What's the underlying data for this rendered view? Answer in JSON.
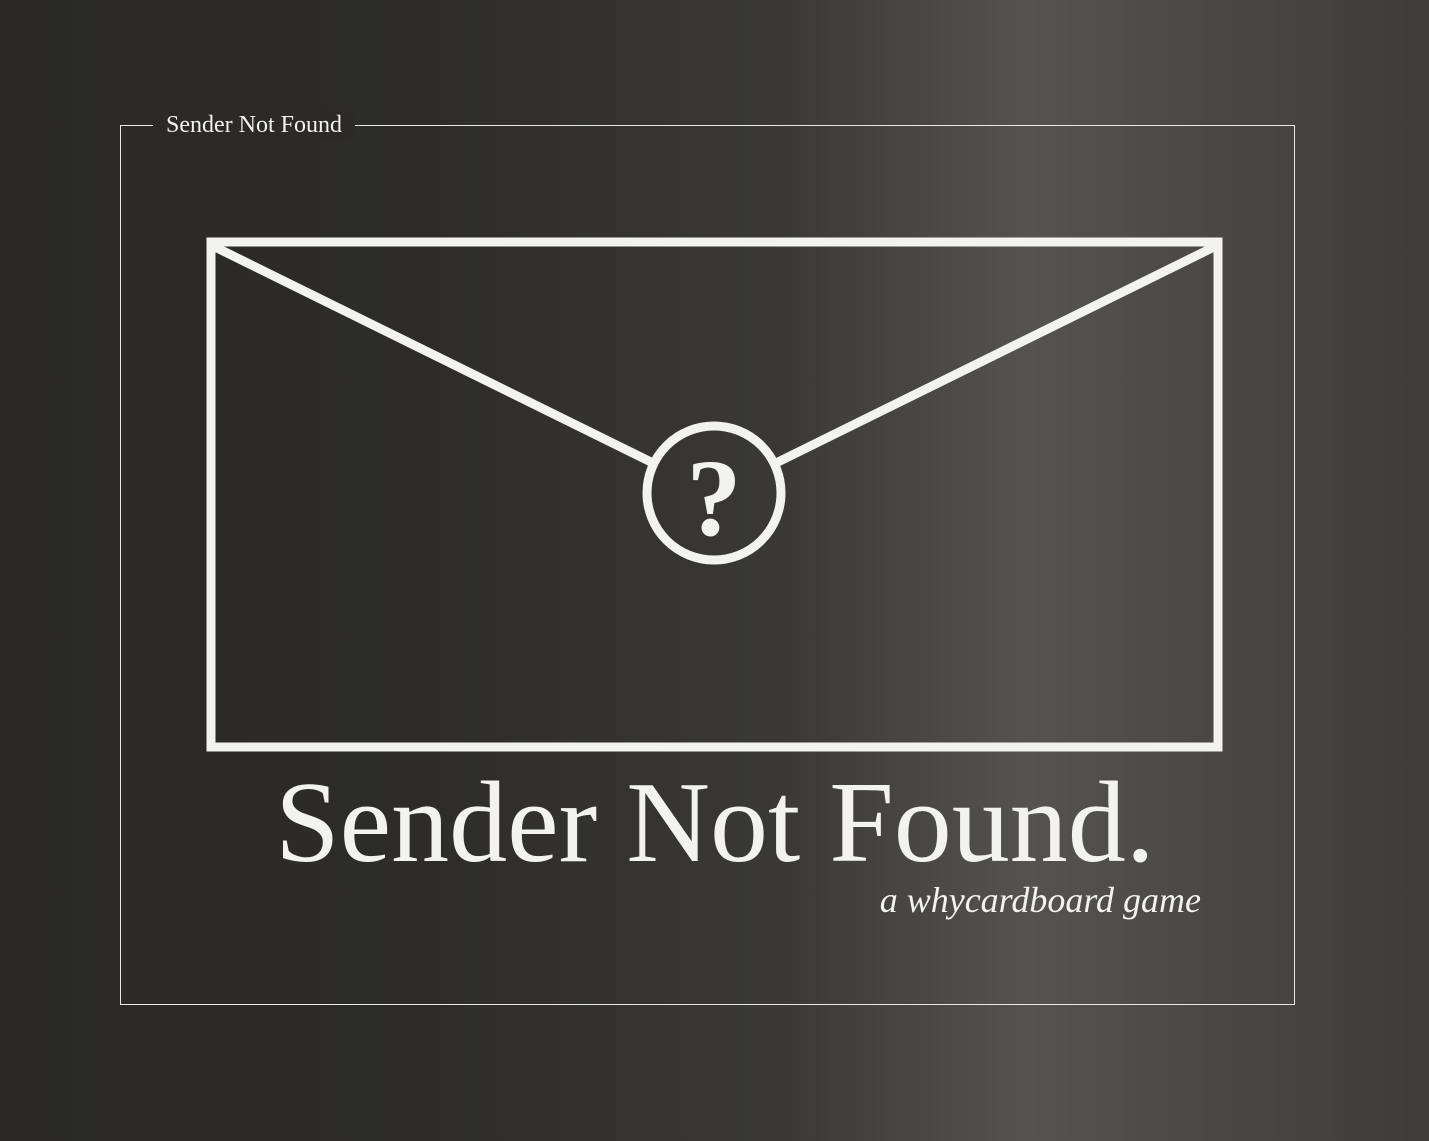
{
  "cover": {
    "frame_label": "Sender Not Found",
    "title": "Sender Not Found.",
    "subtitle": "a whycardboard game",
    "seal_symbol": "?"
  },
  "icons": {
    "envelope": "envelope-icon",
    "seal": "question-seal-icon"
  },
  "colors": {
    "foreground": "#f2f2ee",
    "background": "#2d2c2a"
  }
}
